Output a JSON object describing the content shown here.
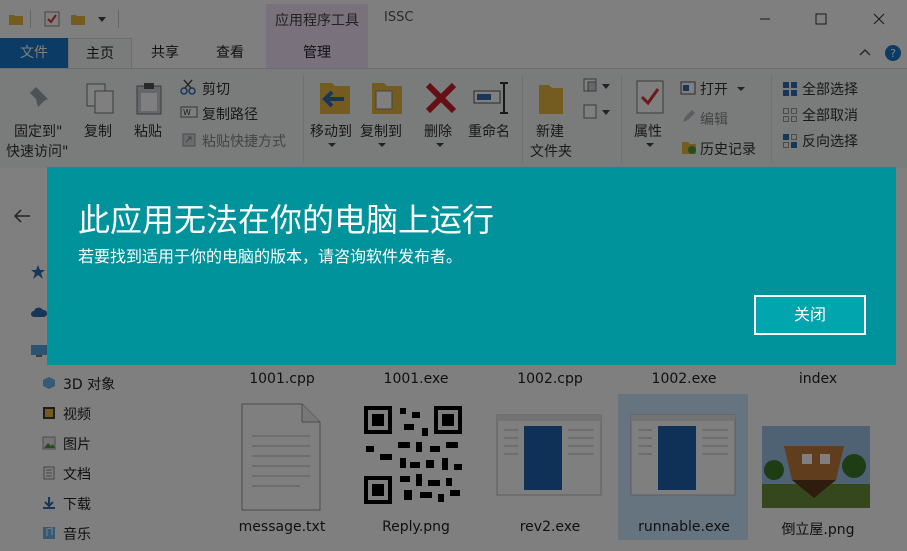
{
  "titlebar": {
    "contextual_tab_title": "应用程序工具",
    "window_title": "ISSC"
  },
  "tabs": {
    "file": "文件",
    "home": "主页",
    "share": "共享",
    "view": "查看",
    "manage": "管理"
  },
  "ribbon": {
    "pin_line1": "固定到\"",
    "pin_line2": "快速访问\"",
    "copy": "复制",
    "paste": "粘贴",
    "cut": "剪切",
    "copy_path": "复制路径",
    "paste_shortcut": "粘贴快捷方式",
    "move_to": "移动到",
    "copy_to": "复制到",
    "delete": "删除",
    "rename": "重命名",
    "new_folder_line1": "新建",
    "new_folder_line2": "文件夹",
    "properties": "属性",
    "open": "打开",
    "edit": "编辑",
    "history": "历史记录",
    "select_all": "全部选择",
    "select_none": "全部取消",
    "invert_selection": "反向选择"
  },
  "nav": {
    "items": [
      "3D 对象",
      "视频",
      "图片",
      "文档",
      "下载",
      "音乐"
    ]
  },
  "files": {
    "row1": [
      "1001.cpp",
      "1001.exe",
      "1002.cpp",
      "1002.exe",
      "index"
    ],
    "row2": [
      "message.txt",
      "Reply.png",
      "rev2.exe",
      "runnable.exe",
      "倒立屋.png"
    ]
  },
  "dialog": {
    "title": "此应用无法在你的电脑上运行",
    "message": "若要找到适用于你的电脑的版本，请咨询软件发布者。",
    "close_label": "关闭",
    "bg_color": "#00939b"
  }
}
